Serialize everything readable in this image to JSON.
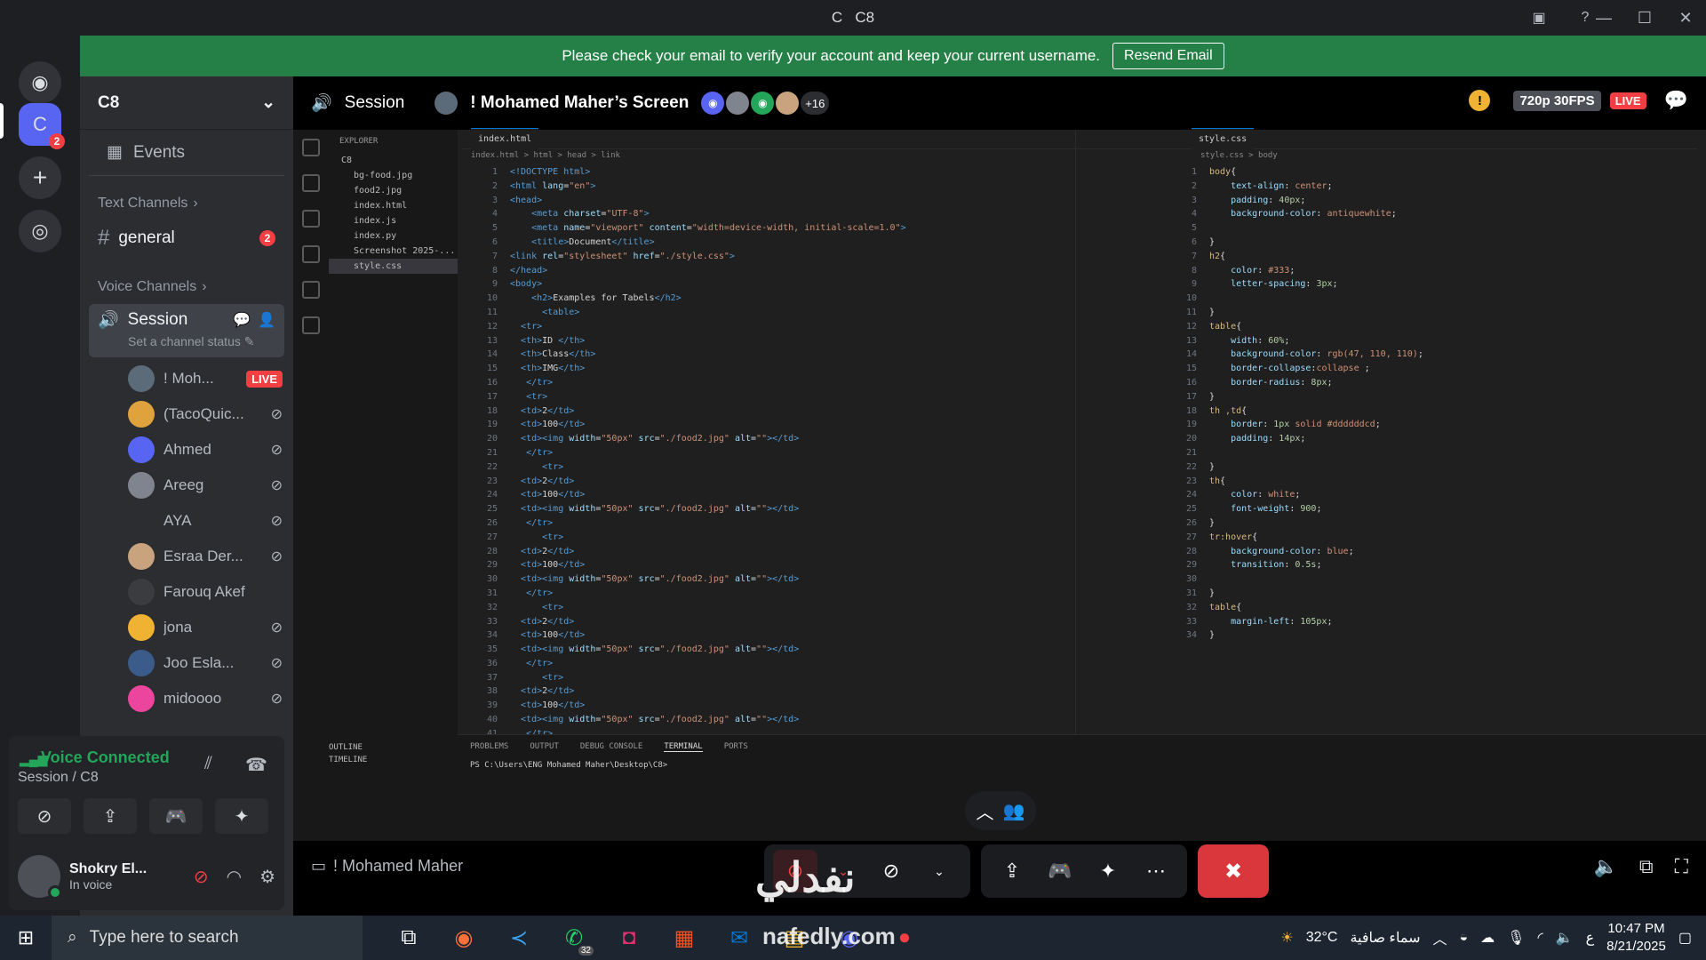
{
  "window": {
    "title": "C8",
    "title_prefix": "C"
  },
  "banner": {
    "text": "Please check your email to verify your account and keep your current username.",
    "button": "Resend Email"
  },
  "rail": {
    "server_badge": "2",
    "server_letter": "C"
  },
  "sidebar": {
    "server_name": "C8",
    "events_label": "Events",
    "text_category": "Text Channels",
    "text_channel": "general",
    "text_badge": "2",
    "voice_category": "Voice Channels",
    "voice_channel": "Session",
    "voice_status_placeholder": "Set a channel status",
    "members": [
      {
        "name": "! Moh...",
        "live": "LIVE",
        "color": "#5c6b7a"
      },
      {
        "name": "(TacoQuic...",
        "color": "#e0a23c"
      },
      {
        "name": "Ahmed",
        "color": "#5865f2"
      },
      {
        "name": "Areeg",
        "color": "#80848e"
      },
      {
        "name": "AYA",
        "color": "#2b2d31"
      },
      {
        "name": "Esraa Der...",
        "color": "#c9a37e"
      },
      {
        "name": "Farouq Akef",
        "color": "#3a3c40"
      },
      {
        "name": "jona",
        "color": "#f0b232"
      },
      {
        "name": "Joo Esla...",
        "color": "#3b5b8a"
      },
      {
        "name": "midoooo",
        "color": "#eb459e"
      }
    ]
  },
  "voice_panel": {
    "title": "Voice Connected",
    "subtitle": "Session / C8"
  },
  "user": {
    "name": "Shokry El...",
    "status": "In voice"
  },
  "stream": {
    "channel": "Session",
    "title": "! Mohamed Maher’s Screen",
    "viewer_more": "+16",
    "quality": "720p 30FPS",
    "live": "LIVE",
    "streamer_label": "! Mohamed Maher"
  },
  "vscode": {
    "explorer_title": "EXPLORER",
    "folder": "C8",
    "files": [
      "bg-food.jpg",
      "food2.jpg",
      "index.html",
      "index.js",
      "index.py",
      "Screenshot 2025-...",
      "style.css"
    ],
    "left_tab": "index.html",
    "left_crumb": "index.html > html > head > link",
    "right_tab": "style.css",
    "right_crumb": "style.css > body",
    "panel_tabs": [
      "PROBLEMS",
      "OUTPUT",
      "DEBUG CONSOLE",
      "TERMINAL",
      "PORTS"
    ],
    "terminal_line": "PS C:\\Users\\ENG Mohamed Maher\\Desktop\\C8>",
    "outline": "OUTLINE",
    "timeline": "TIMELINE"
  },
  "taskbar": {
    "search_placeholder": "Type here to search",
    "whatsapp_count": "32",
    "weather_temp": "32°C",
    "weather_text": "سماء صافية",
    "time": "10:47 PM",
    "date": "8/21/2025",
    "lang": "ع"
  },
  "watermark": {
    "line1": "نفدلي",
    "line2": "nafedly.com"
  }
}
